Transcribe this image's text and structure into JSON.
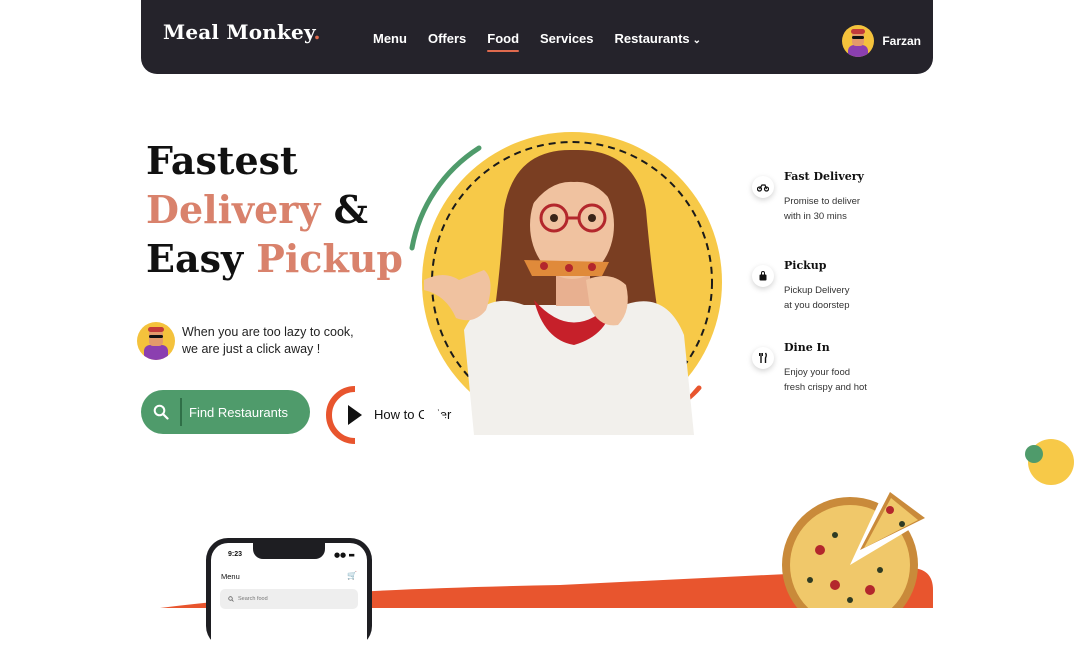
{
  "nav": {
    "brand": "Meal Monkey",
    "brand_dot": ".",
    "links": [
      "Menu",
      "Offers",
      "Food",
      "Services",
      "Restaurants"
    ],
    "active_link": "Food",
    "user_name": "Farzan"
  },
  "hero": {
    "line1": "Fastest",
    "line2_accent": "Delivery",
    "line2_rest": " &",
    "line3_start": "Easy ",
    "line3_accent": "Pickup",
    "tagline_line1": "When you are too lazy to cook,",
    "tagline_line2": "we are just a click away !",
    "find_label": "Find Restaurants",
    "how_label": "How to Order"
  },
  "features": [
    {
      "title": "Fast Delivery",
      "desc1": "Promise to deliver",
      "desc2": "with in 30 mins",
      "icon": "bike-icon"
    },
    {
      "title": "Pickup",
      "desc1": "Pickup Delivery",
      "desc2": "at you doorstep",
      "icon": "bag-icon"
    },
    {
      "title": "Dine In",
      "desc1": "Enjoy your food",
      "desc2": "fresh crispy and hot",
      "icon": "fork-knife-icon"
    }
  ],
  "phone": {
    "time": "9:23",
    "menu": "Menu",
    "search_placeholder": "Search food"
  },
  "colors": {
    "dark": "#25232b",
    "accent": "#d9826c",
    "green": "#4f9b6b",
    "yellow": "#f7c948",
    "orange": "#e8552e"
  }
}
